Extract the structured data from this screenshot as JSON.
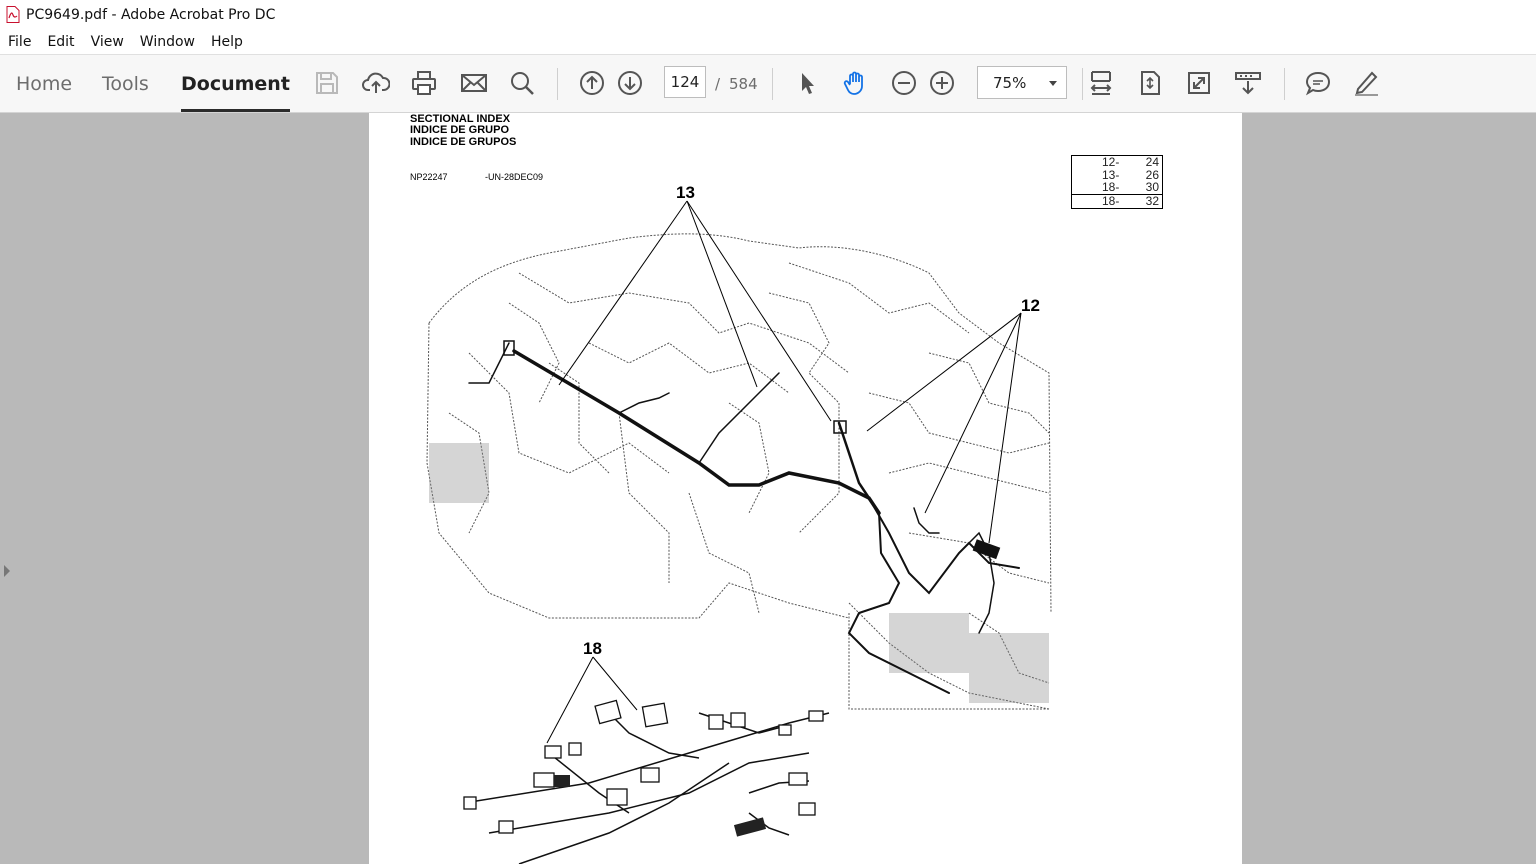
{
  "window": {
    "title": "PC9649.pdf - Adobe Acrobat Pro DC"
  },
  "menu": [
    "File",
    "Edit",
    "View",
    "Window",
    "Help"
  ],
  "toolbar": {
    "tabs": [
      "Home",
      "Tools",
      "Document"
    ],
    "active_tab": "Document",
    "page_current": "124",
    "page_separator": "/",
    "page_total": "584",
    "zoom": "75%",
    "icons": [
      "save-icon",
      "upload-icon",
      "print-icon",
      "email-icon",
      "search-icon",
      "prev-page-icon",
      "next-page-icon",
      "select-icon",
      "hand-icon",
      "zoom-out-icon",
      "zoom-in-icon",
      "fit-width-icon",
      "fit-page-icon",
      "full-screen-icon",
      "scroll-mode-icon",
      "comment-icon",
      "sign-icon"
    ]
  },
  "document": {
    "header": [
      "SECTIONAL INDEX",
      "INDICE DE GRUPO",
      "INDICE DE GRUPOS"
    ],
    "code": "NP22247",
    "code_suffix": "-UN-28DEC09",
    "ref_table": [
      {
        "section": "12-",
        "page": "24"
      },
      {
        "section": "13-",
        "page": "26"
      },
      {
        "section": "18-",
        "page": "30"
      },
      {
        "section": "18-",
        "page": "32"
      }
    ],
    "callouts": [
      "13",
      "12",
      "18"
    ]
  }
}
